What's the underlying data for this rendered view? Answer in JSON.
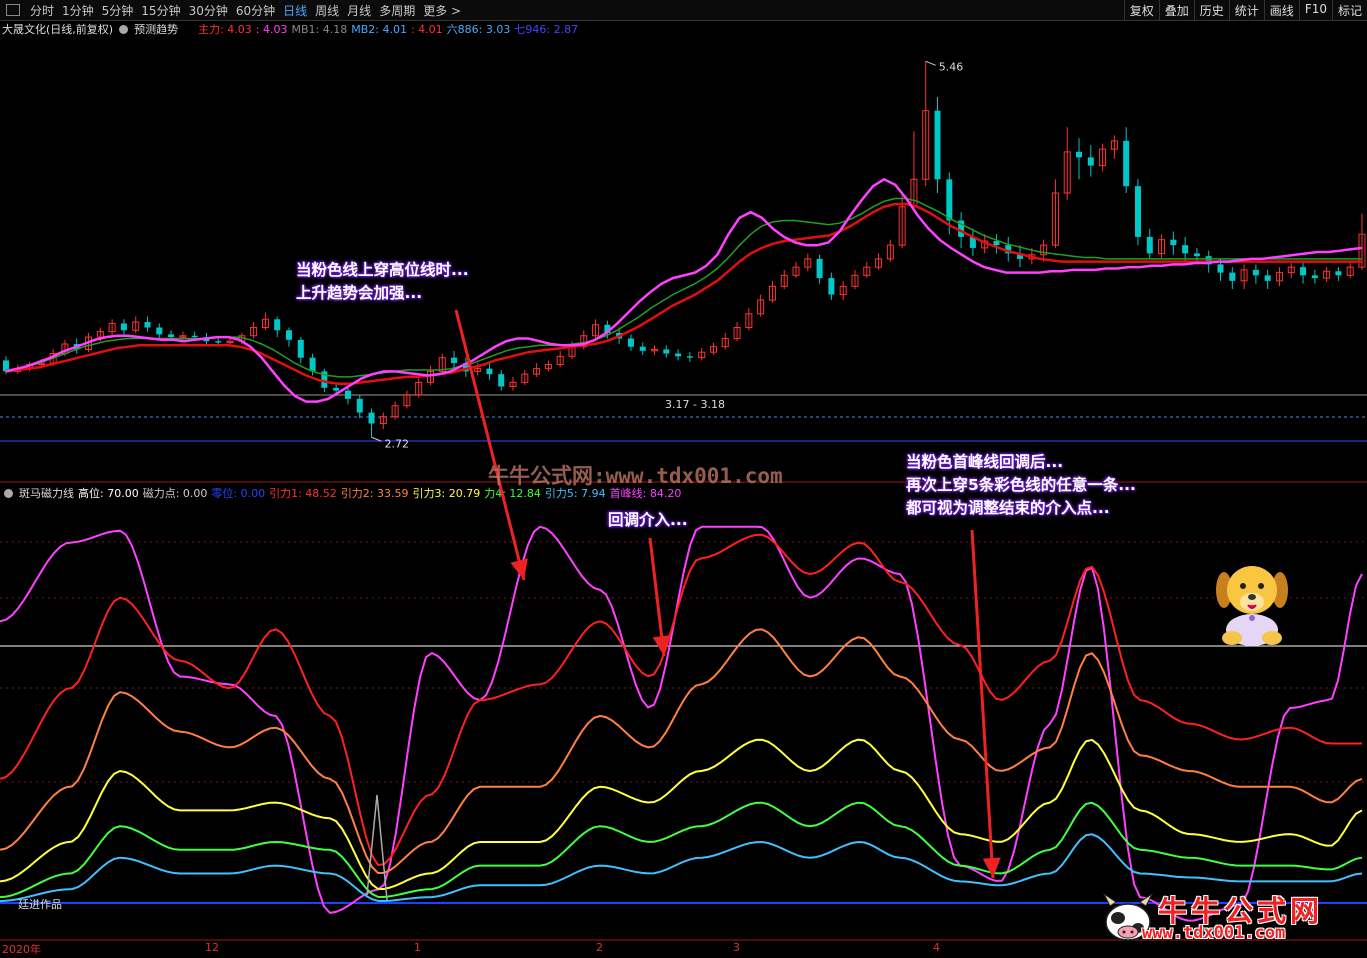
{
  "toolbar": {
    "periods": [
      "分时",
      "1分钟",
      "5分钟",
      "15分钟",
      "30分钟",
      "60分钟",
      "日线",
      "周线",
      "月线",
      "多周期",
      "更多 >"
    ],
    "active": "日线",
    "right_buttons": [
      "复权",
      "叠加",
      "历史",
      "统计",
      "画线",
      "F10",
      "标记"
    ]
  },
  "main_panel": {
    "stock": "大晟文化(日线,前复权)",
    "trend_label": "预测趋势",
    "indicators": [
      {
        "label": "主力: 4.03",
        "color": "#ff3030"
      },
      {
        "label": ": 4.03",
        "color": "#ff40ff"
      },
      {
        "label": "MB1: 4.18",
        "color": "#888888"
      },
      {
        "label": "MB2: 4.01",
        "color": "#44aaff"
      },
      {
        "label": ": 4.01",
        "color": "#ff3030"
      },
      {
        "label": "六886: 3.03",
        "color": "#44aaff"
      },
      {
        "label": "七946: 2.87",
        "color": "#4444ff"
      }
    ],
    "high_label": "5.46",
    "low_label": "2.72",
    "range_label": "3.17 - 3.18"
  },
  "sub_panel": {
    "name": "斑马磁力线",
    "indicators": [
      {
        "label": "高位: 70.00",
        "color": "#ffffff"
      },
      {
        "label": "磁力点: 0.00",
        "color": "#cccccc"
      },
      {
        "label": "零位: 0.00",
        "color": "#2244ff"
      },
      {
        "label": "引力1: 48.52",
        "color": "#ff3030"
      },
      {
        "label": "引力2: 33.59",
        "color": "#ff8040"
      },
      {
        "label": "引力3: 20.79",
        "color": "#ffff40"
      },
      {
        "label": "力4: 12.84",
        "color": "#40ff40"
      },
      {
        "label": "引力5: 7.94",
        "color": "#40c0ff"
      },
      {
        "label": "首峰线: 84.20",
        "color": "#ff40ff"
      }
    ],
    "author": "廷进作品"
  },
  "annotations": {
    "a1": [
      "当粉色线上穿高位线时...",
      "上升趋势会加强..."
    ],
    "a2": [
      "回调介入..."
    ],
    "a3": [
      "当粉色首峰线回调后...",
      "再次上穿5条彩色线的任意一条...",
      "都可视为调整结束的介入点..."
    ]
  },
  "watermark": "牛牛公式网:www.tdx001.com",
  "logo": {
    "title": "牛牛公式网",
    "url": "www.tdx001.com"
  },
  "x_axis": [
    "2020年",
    "12",
    "1",
    "2",
    "3",
    "4"
  ],
  "colors": {
    "up": "#ff3232",
    "down": "#00c8c8",
    "pink": "#ff40ff",
    "red": "#e01010",
    "green": "#20a020",
    "blue": "#4a90e0",
    "high_line": "#ffffff",
    "zero_line": "#2040ff"
  },
  "chart_data": {
    "type": "line",
    "main": {
      "price_ref": {
        "low": 2.72,
        "high": 5.46,
        "range": [
          3.17,
          3.18
        ]
      },
      "candles": [
        [
          3.28,
          3.2,
          3.31,
          3.18
        ],
        [
          3.2,
          3.22,
          3.25,
          3.18
        ],
        [
          3.22,
          3.25,
          3.27,
          3.2
        ],
        [
          3.25,
          3.26,
          3.29,
          3.22
        ],
        [
          3.26,
          3.33,
          3.36,
          3.24
        ],
        [
          3.33,
          3.4,
          3.43,
          3.31
        ],
        [
          3.4,
          3.36,
          3.44,
          3.33
        ],
        [
          3.36,
          3.45,
          3.48,
          3.34
        ],
        [
          3.45,
          3.49,
          3.52,
          3.42
        ],
        [
          3.49,
          3.55,
          3.58,
          3.46
        ],
        [
          3.55,
          3.5,
          3.58,
          3.47
        ],
        [
          3.5,
          3.56,
          3.6,
          3.48
        ],
        [
          3.56,
          3.52,
          3.6,
          3.49
        ],
        [
          3.52,
          3.47,
          3.55,
          3.44
        ],
        [
          3.47,
          3.45,
          3.5,
          3.42
        ],
        [
          3.45,
          3.46,
          3.49,
          3.42
        ],
        [
          3.46,
          3.45,
          3.49,
          3.43
        ],
        [
          3.45,
          3.42,
          3.48,
          3.39
        ],
        [
          3.42,
          3.41,
          3.45,
          3.38
        ],
        [
          3.41,
          3.42,
          3.45,
          3.39
        ],
        [
          3.42,
          3.46,
          3.48,
          3.4
        ],
        [
          3.46,
          3.52,
          3.56,
          3.44
        ],
        [
          3.52,
          3.58,
          3.63,
          3.5
        ],
        [
          3.58,
          3.5,
          3.6,
          3.45
        ],
        [
          3.5,
          3.43,
          3.52,
          3.38
        ],
        [
          3.43,
          3.3,
          3.45,
          3.26
        ],
        [
          3.3,
          3.2,
          3.33,
          3.17
        ],
        [
          3.2,
          3.08,
          3.22,
          3.05
        ],
        [
          3.08,
          3.06,
          3.12,
          3.02
        ],
        [
          3.06,
          3.0,
          3.09,
          2.96
        ],
        [
          3.0,
          2.9,
          3.03,
          2.86
        ],
        [
          2.9,
          2.82,
          2.93,
          2.72
        ],
        [
          2.82,
          2.87,
          2.9,
          2.78
        ],
        [
          2.87,
          2.95,
          2.98,
          2.85
        ],
        [
          2.95,
          3.03,
          3.06,
          2.93
        ],
        [
          3.03,
          3.12,
          3.15,
          3.01
        ],
        [
          3.12,
          3.2,
          3.24,
          3.1
        ],
        [
          3.2,
          3.3,
          3.33,
          3.18
        ],
        [
          3.3,
          3.26,
          3.35,
          3.22
        ],
        [
          3.26,
          3.2,
          3.3,
          3.16
        ],
        [
          3.2,
          3.22,
          3.26,
          3.17
        ],
        [
          3.22,
          3.18,
          3.26,
          3.14
        ],
        [
          3.18,
          3.09,
          3.21,
          3.06
        ],
        [
          3.09,
          3.12,
          3.16,
          3.06
        ],
        [
          3.12,
          3.18,
          3.21,
          3.1
        ],
        [
          3.18,
          3.22,
          3.26,
          3.16
        ],
        [
          3.22,
          3.25,
          3.28,
          3.2
        ],
        [
          3.25,
          3.31,
          3.35,
          3.23
        ],
        [
          3.31,
          3.38,
          3.42,
          3.29
        ],
        [
          3.38,
          3.46,
          3.5,
          3.36
        ],
        [
          3.46,
          3.54,
          3.58,
          3.44
        ],
        [
          3.54,
          3.48,
          3.57,
          3.44
        ],
        [
          3.48,
          3.44,
          3.52,
          3.4
        ],
        [
          3.44,
          3.38,
          3.47,
          3.35
        ],
        [
          3.38,
          3.35,
          3.41,
          3.32
        ],
        [
          3.35,
          3.36,
          3.39,
          3.32
        ],
        [
          3.36,
          3.33,
          3.39,
          3.3
        ],
        [
          3.33,
          3.31,
          3.36,
          3.28
        ],
        [
          3.31,
          3.3,
          3.34,
          3.27
        ],
        [
          3.3,
          3.34,
          3.37,
          3.28
        ],
        [
          3.34,
          3.38,
          3.41,
          3.32
        ],
        [
          3.38,
          3.44,
          3.48,
          3.36
        ],
        [
          3.44,
          3.52,
          3.56,
          3.42
        ],
        [
          3.52,
          3.62,
          3.66,
          3.5
        ],
        [
          3.62,
          3.72,
          3.76,
          3.6
        ],
        [
          3.72,
          3.82,
          3.86,
          3.7
        ],
        [
          3.82,
          3.9,
          3.94,
          3.8
        ],
        [
          3.9,
          3.96,
          4.0,
          3.88
        ],
        [
          3.96,
          4.02,
          4.06,
          3.93
        ],
        [
          4.02,
          3.88,
          4.05,
          3.84
        ],
        [
          3.88,
          3.76,
          3.92,
          3.72
        ],
        [
          3.76,
          3.82,
          3.86,
          3.72
        ],
        [
          3.82,
          3.9,
          3.94,
          3.8
        ],
        [
          3.9,
          3.96,
          4.0,
          3.88
        ],
        [
          3.96,
          4.02,
          4.06,
          3.94
        ],
        [
          4.02,
          4.12,
          4.16,
          4.0
        ],
        [
          4.12,
          4.4,
          4.5,
          4.1
        ],
        [
          4.4,
          4.6,
          4.95,
          4.38
        ],
        [
          4.6,
          5.1,
          5.46,
          4.55
        ],
        [
          5.1,
          4.6,
          5.2,
          4.5
        ],
        [
          4.6,
          4.3,
          4.65,
          4.2
        ],
        [
          4.3,
          4.18,
          4.36,
          4.1
        ],
        [
          4.18,
          4.1,
          4.24,
          4.04
        ],
        [
          4.1,
          4.15,
          4.2,
          4.06
        ],
        [
          4.15,
          4.12,
          4.2,
          4.06
        ],
        [
          4.12,
          4.06,
          4.18,
          4.0
        ],
        [
          4.06,
          4.02,
          4.12,
          3.96
        ],
        [
          4.02,
          4.05,
          4.1,
          3.98
        ],
        [
          4.05,
          4.12,
          4.16,
          4.0
        ],
        [
          4.12,
          4.5,
          4.6,
          4.1
        ],
        [
          4.5,
          4.8,
          4.98,
          4.45
        ],
        [
          4.8,
          4.76,
          4.9,
          4.6
        ],
        [
          4.76,
          4.7,
          4.85,
          4.62
        ],
        [
          4.7,
          4.82,
          4.86,
          4.66
        ],
        [
          4.82,
          4.88,
          4.92,
          4.75
        ],
        [
          4.88,
          4.55,
          4.98,
          4.5
        ],
        [
          4.55,
          4.18,
          4.6,
          4.12
        ],
        [
          4.18,
          4.06,
          4.24,
          4.02
        ],
        [
          4.06,
          4.16,
          4.2,
          4.02
        ],
        [
          4.16,
          4.12,
          4.22,
          4.05
        ],
        [
          4.12,
          4.06,
          4.18,
          4.0
        ],
        [
          4.06,
          4.04,
          4.1,
          3.98
        ],
        [
          4.04,
          3.98,
          4.08,
          3.92
        ],
        [
          3.98,
          3.92,
          4.02,
          3.86
        ],
        [
          3.92,
          3.86,
          3.96,
          3.8
        ],
        [
          3.86,
          3.94,
          3.98,
          3.8
        ],
        [
          3.94,
          3.9,
          3.98,
          3.84
        ],
        [
          3.9,
          3.86,
          3.94,
          3.8
        ],
        [
          3.86,
          3.92,
          3.96,
          3.82
        ],
        [
          3.92,
          3.96,
          4.0,
          3.88
        ],
        [
          3.96,
          3.9,
          4.0,
          3.84
        ],
        [
          3.9,
          3.88,
          3.94,
          3.84
        ],
        [
          3.88,
          3.93,
          3.96,
          3.85
        ],
        [
          3.93,
          3.9,
          3.96,
          3.86
        ],
        [
          3.9,
          3.96,
          4.0,
          3.88
        ],
        [
          3.96,
          4.2,
          4.35,
          3.94
        ]
      ],
      "ma_pink": [
        3.2,
        3.22,
        3.24,
        3.27,
        3.3,
        3.34,
        3.37,
        3.4,
        3.43,
        3.45,
        3.46,
        3.46,
        3.45,
        3.44,
        3.43,
        3.43,
        3.42,
        3.43,
        3.44,
        3.45,
        3.45,
        3.43,
        3.38,
        3.3,
        3.2,
        3.1,
        3.02,
        2.98,
        2.98,
        3.0,
        3.05,
        3.1,
        3.15,
        3.18,
        3.2,
        3.2,
        3.19,
        3.18,
        3.17,
        3.18,
        3.2,
        3.24,
        3.28,
        3.33,
        3.38,
        3.42,
        3.44,
        3.44,
        3.42,
        3.4,
        3.39,
        3.39,
        3.4,
        3.43,
        3.48,
        3.55,
        3.63,
        3.71,
        3.78,
        3.84,
        3.88,
        3.9,
        3.92,
        3.97,
        4.05,
        4.2,
        4.32,
        4.36,
        4.32,
        4.24,
        4.18,
        4.14,
        4.12,
        4.12,
        4.14,
        4.22,
        4.34,
        4.45,
        4.55,
        4.6,
        4.56,
        4.46,
        4.34,
        4.24,
        4.16,
        4.1,
        4.05,
        4.0,
        3.96,
        3.94,
        3.92,
        3.92,
        3.92,
        3.92,
        3.93,
        3.93,
        3.94,
        3.94,
        3.94,
        3.95,
        3.95,
        3.96,
        3.96,
        3.97,
        3.97,
        3.98,
        3.98,
        3.99,
        3.99,
        4.0,
        4.0,
        4.01,
        4.02,
        4.02,
        4.03,
        4.04,
        4.05,
        4.06,
        4.07,
        4.07,
        4.08,
        4.09,
        4.1
      ],
      "ma_red": [
        3.2,
        3.21,
        3.22,
        3.23,
        3.25,
        3.27,
        3.29,
        3.31,
        3.33,
        3.35,
        3.37,
        3.38,
        3.39,
        3.39,
        3.39,
        3.39,
        3.39,
        3.39,
        3.39,
        3.39,
        3.39,
        3.38,
        3.36,
        3.33,
        3.29,
        3.25,
        3.21,
        3.17,
        3.14,
        3.12,
        3.11,
        3.11,
        3.12,
        3.13,
        3.14,
        3.15,
        3.16,
        3.16,
        3.17,
        3.18,
        3.19,
        3.21,
        3.23,
        3.25,
        3.28,
        3.3,
        3.32,
        3.34,
        3.35,
        3.36,
        3.37,
        3.38,
        3.39,
        3.4,
        3.42,
        3.45,
        3.49,
        3.53,
        3.58,
        3.63,
        3.68,
        3.72,
        3.76,
        3.81,
        3.86,
        3.93,
        4.0,
        4.06,
        4.1,
        4.13,
        4.15,
        4.16,
        4.17,
        4.18,
        4.19,
        4.22,
        4.26,
        4.31,
        4.36,
        4.4,
        4.42,
        4.42,
        4.4,
        4.36,
        4.31,
        4.26,
        4.22,
        4.18,
        4.14,
        4.11,
        4.08,
        4.06,
        4.04,
        4.02,
        4.01,
        4.0,
        4.0,
        4.0,
        4.0,
        4.0,
        4.0,
        4.0,
        4.0,
        4.0,
        4.0,
        4.0,
        4.0,
        4.0,
        4.0,
        4.0,
        4.0,
        4.0,
        4.0,
        4.0,
        4.0,
        4.0,
        4.0,
        4.0,
        4.0,
        4.0,
        4.0,
        4.0,
        4.0
      ],
      "ma_green": [
        3.21,
        3.22,
        3.24,
        3.26,
        3.29,
        3.32,
        3.35,
        3.38,
        3.4,
        3.42,
        3.43,
        3.44,
        3.44,
        3.44,
        3.44,
        3.44,
        3.44,
        3.44,
        3.44,
        3.45,
        3.45,
        3.45,
        3.43,
        3.4,
        3.36,
        3.31,
        3.26,
        3.22,
        3.19,
        3.17,
        3.16,
        3.16,
        3.17,
        3.18,
        3.19,
        3.2,
        3.21,
        3.21,
        3.21,
        3.21,
        3.22,
        3.24,
        3.26,
        3.29,
        3.32,
        3.35,
        3.37,
        3.38,
        3.39,
        3.39,
        3.39,
        3.4,
        3.41,
        3.43,
        3.46,
        3.5,
        3.55,
        3.6,
        3.66,
        3.71,
        3.76,
        3.8,
        3.84,
        3.89,
        3.95,
        4.03,
        4.12,
        4.2,
        4.26,
        4.29,
        4.3,
        4.3,
        4.29,
        4.28,
        4.27,
        4.28,
        4.31,
        4.35,
        4.4,
        4.44,
        4.46,
        4.46,
        4.44,
        4.4,
        4.36,
        4.31,
        4.27,
        4.23,
        4.19,
        4.16,
        4.13,
        4.11,
        4.09,
        4.07,
        4.06,
        4.05,
        4.04,
        4.03,
        4.03,
        4.02,
        4.02,
        4.02,
        4.02,
        4.02,
        4.02,
        4.02,
        4.02,
        4.02,
        4.02,
        4.02,
        4.02,
        4.02,
        4.02,
        4.02,
        4.02,
        4.02,
        4.02,
        4.02,
        4.02,
        4.02,
        4.02,
        4.02,
        4.02
      ]
    },
    "sub": {
      "y_range": [
        -5,
        110
      ],
      "high_level": 70,
      "zero_level": 0,
      "series": [
        {
          "label": "首峰线",
          "color": "#ff40ff",
          "end": 84.2
        },
        {
          "label": "引力1",
          "color": "#ff2020",
          "end": 48.52
        },
        {
          "label": "引力2",
          "color": "#ff8040",
          "end": 33.59
        },
        {
          "label": "引力3",
          "color": "#ffff40",
          "end": 20.79
        },
        {
          "label": "力4",
          "color": "#40ff40",
          "end": 12.84
        },
        {
          "label": "引力5",
          "color": "#40c0ff",
          "end": 7.94
        }
      ]
    }
  }
}
